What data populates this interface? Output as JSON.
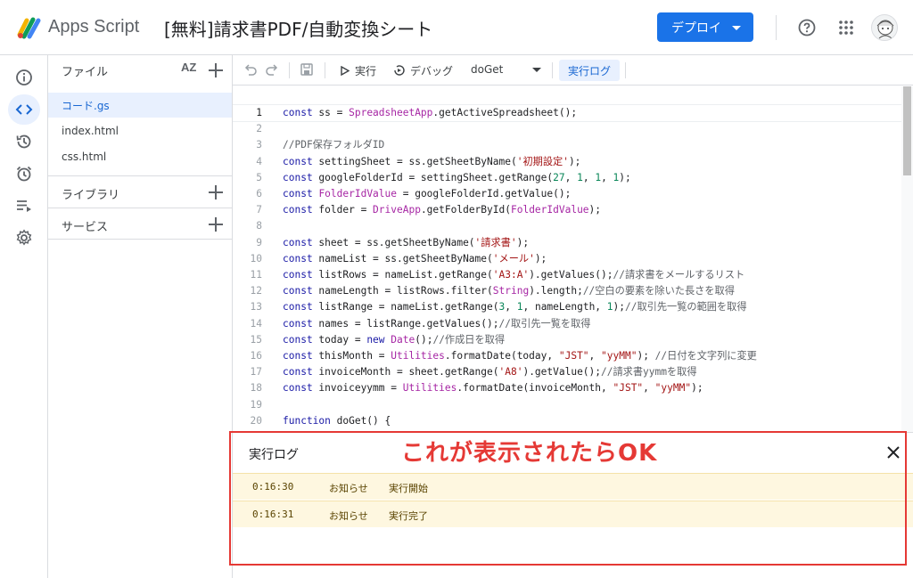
{
  "header": {
    "app_name": "Apps Script",
    "project_title": "[無料]請求書PDF/自動変換シート",
    "deploy_label": "デプロイ"
  },
  "rail": {
    "icons": [
      "info-icon",
      "code-icon",
      "history-icon",
      "alarm-icon",
      "executions-icon",
      "settings-icon"
    ],
    "active": "code-icon"
  },
  "files": {
    "title": "ファイル",
    "sort_label": "AZ",
    "items": [
      {
        "label": "コード.gs",
        "active": true
      },
      {
        "label": "index.html",
        "active": false
      },
      {
        "label": "css.html",
        "active": false
      }
    ],
    "library_label": "ライブラリ",
    "services_label": "サービス"
  },
  "toolbar": {
    "run_label": "実行",
    "debug_label": "デバッグ",
    "function_name": "doGet",
    "log_label": "実行ログ"
  },
  "editor": {
    "lines": [
      {
        "n": "1",
        "text": "const ss = SpreadsheetApp.getActiveSpreadsheet();"
      },
      {
        "n": "2",
        "text": ""
      },
      {
        "n": "3",
        "text": "//PDF保存フォルダID"
      },
      {
        "n": "4",
        "text": "const settingSheet = ss.getSheetByName('初期設定');"
      },
      {
        "n": "5",
        "text": "const googleFolderId = settingSheet.getRange(27, 1, 1, 1);"
      },
      {
        "n": "6",
        "text": "const FolderIdValue = googleFolderId.getValue();"
      },
      {
        "n": "7",
        "text": "const folder = DriveApp.getFolderById(FolderIdValue);"
      },
      {
        "n": "8",
        "text": ""
      },
      {
        "n": "9",
        "text": "const sheet = ss.getSheetByName('請求書');"
      },
      {
        "n": "10",
        "text": "const nameList = ss.getSheetByName('メール');"
      },
      {
        "n": "11",
        "text": "const listRows = nameList.getRange('A3:A').getValues();//請求書をメールするリスト"
      },
      {
        "n": "12",
        "text": "const nameLength = listRows.filter(String).length;//空白の要素を除いた長さを取得"
      },
      {
        "n": "13",
        "text": "const listRange = nameList.getRange(3, 1, nameLength, 1);//取引先一覧の範囲を取得"
      },
      {
        "n": "14",
        "text": "const names = listRange.getValues();//取引先一覧を取得"
      },
      {
        "n": "15",
        "text": "const today = new Date();//作成日を取得"
      },
      {
        "n": "16",
        "text": "const thisMonth = Utilities.formatDate(today, \"JST\", \"yyMM\"); //日付を文字列に変更"
      },
      {
        "n": "17",
        "text": "const invoiceMonth = sheet.getRange('A8').getValue();//請求書yymmを取得"
      },
      {
        "n": "18",
        "text": "const invoiceyymm = Utilities.formatDate(invoiceMonth, \"JST\", \"yyMM\");"
      },
      {
        "n": "19",
        "text": ""
      },
      {
        "n": "20",
        "text": "function doGet() {"
      }
    ]
  },
  "log": {
    "title": "実行ログ",
    "rows": [
      {
        "time": "0:16:30",
        "level": "お知らせ",
        "message": "実行開始"
      },
      {
        "time": "0:16:31",
        "level": "お知らせ",
        "message": "実行完了"
      }
    ]
  },
  "annotation": {
    "text": "これが表示されたらOK",
    "color": "#e53935"
  }
}
